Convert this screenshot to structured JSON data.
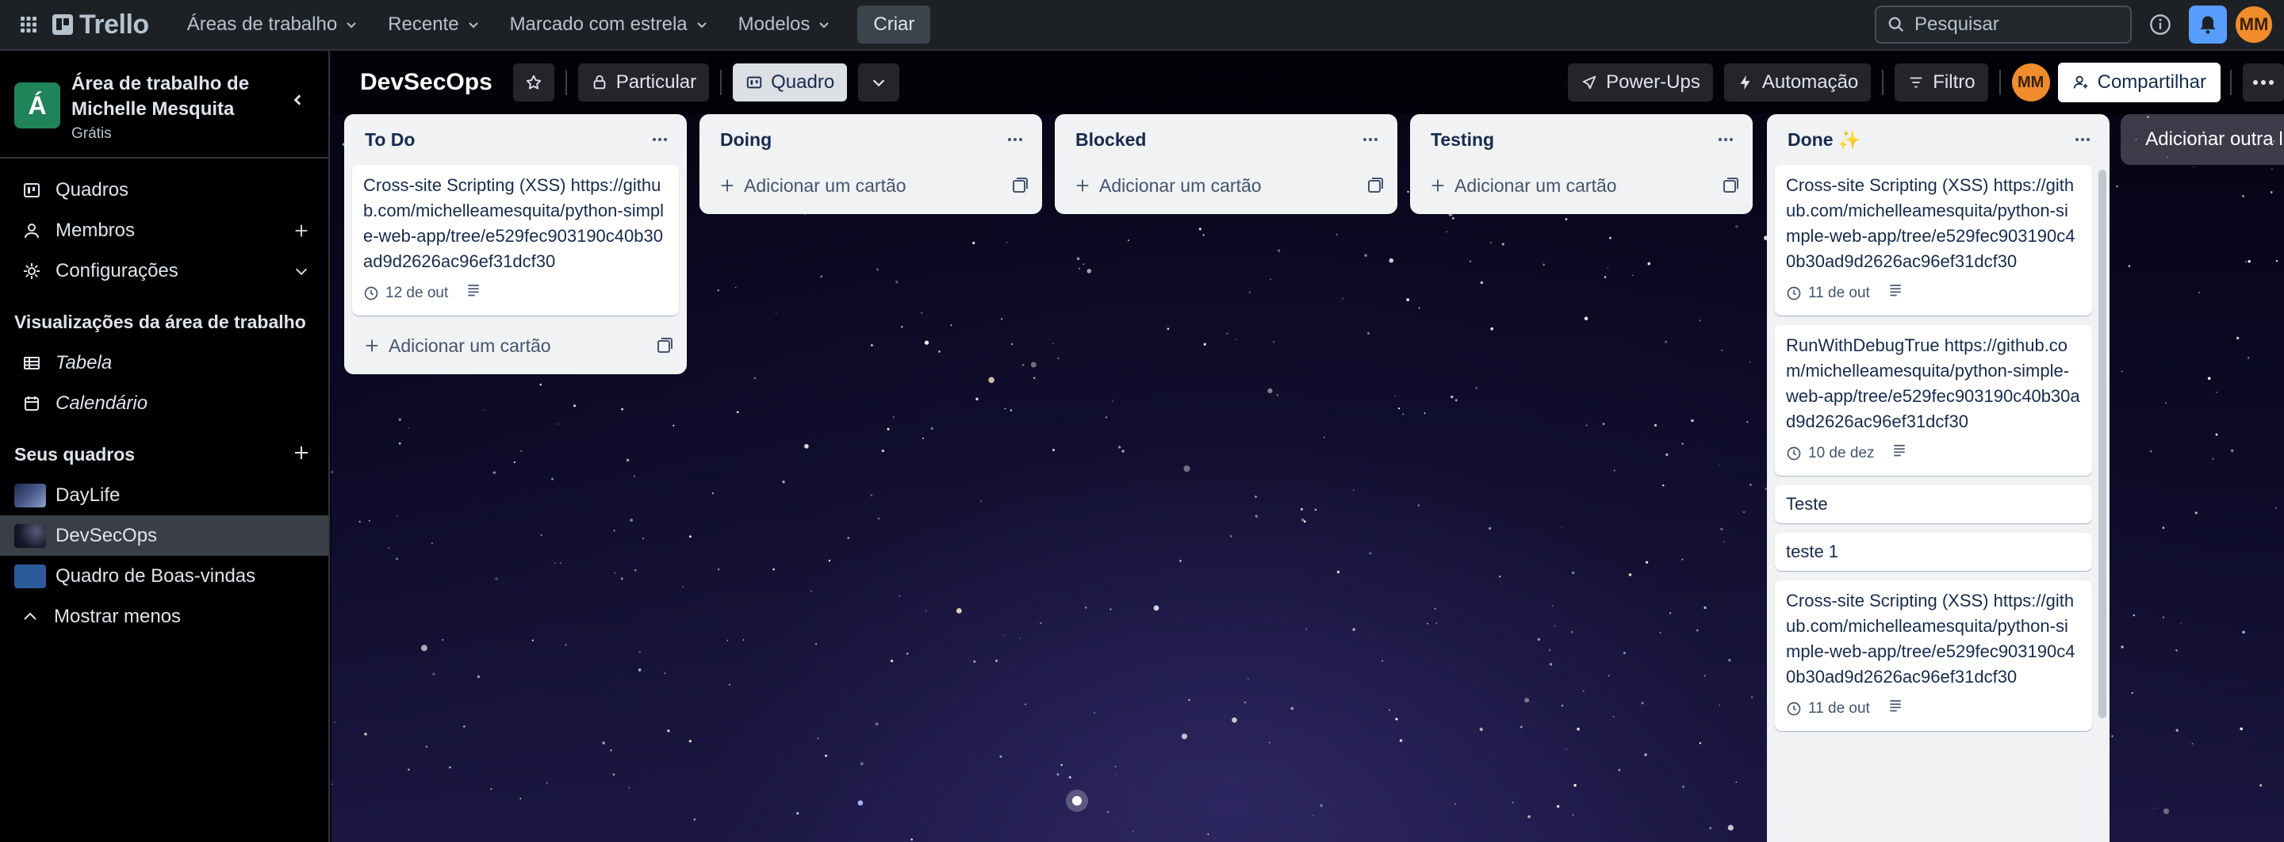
{
  "topbar": {
    "logo": "Trello",
    "menus": [
      "Áreas de trabalho",
      "Recente",
      "Marcado com estrela",
      "Modelos"
    ],
    "create_label": "Criar",
    "search_placeholder": "Pesquisar",
    "avatar_initials": "MM"
  },
  "sidebar": {
    "workspace_initial": "Á",
    "workspace_name": "Área de trabalho de Michelle Mesquita",
    "workspace_plan": "Grátis",
    "nav": [
      {
        "label": "Quadros",
        "icon": "board-icon"
      },
      {
        "label": "Membros",
        "icon": "members-icon"
      },
      {
        "label": "Configurações",
        "icon": "gear-icon"
      }
    ],
    "views_heading": "Visualizações da área de trabalho",
    "views": [
      {
        "label": "Tabela",
        "icon": "table-icon"
      },
      {
        "label": "Calendário",
        "icon": "calendar-icon"
      }
    ],
    "boards_heading": "Seus quadros",
    "boards": [
      {
        "label": "DayLife",
        "active": false
      },
      {
        "label": "DevSecOps",
        "active": true
      },
      {
        "label": "Quadro de Boas-vindas",
        "active": false
      }
    ],
    "show_less": "Mostrar menos"
  },
  "board": {
    "title": "DevSecOps",
    "visibility": "Particular",
    "view": "Quadro",
    "powerups": "Power-Ups",
    "automation": "Automação",
    "filter": "Filtro",
    "member_initials": "MM",
    "share": "Compartilhar",
    "add_card": "Adicionar um cartão",
    "add_list": "Adicionar outra lista",
    "lists": [
      {
        "title": "To Do",
        "cards": [
          {
            "text": "Cross-site Scripting (XSS) https://github.com/michelleamesquita/python-simple-web-app/tree/e529fec903190c40b30ad9d2626ac96ef31dcf30",
            "due": "12 de out",
            "desc": true
          }
        ]
      },
      {
        "title": "Doing",
        "cards": []
      },
      {
        "title": "Blocked",
        "cards": []
      },
      {
        "title": "Testing",
        "cards": []
      },
      {
        "title": "Done ✨",
        "cards": [
          {
            "text": "Cross-site Scripting (XSS) https://github.com/michelleamesquita/python-simple-web-app/tree/e529fec903190c40b30ad9d2626ac96ef31dcf30",
            "due": "11 de out",
            "desc": true
          },
          {
            "text": "RunWithDebugTrue https://github.com/michelleamesquita/python-simple-web-app/tree/e529fec903190c40b30ad9d2626ac96ef31dcf30",
            "due": "10 de dez",
            "desc": true
          },
          {
            "text": "Teste"
          },
          {
            "text": "teste 1"
          },
          {
            "text": "Cross-site Scripting (XSS) https://github.com/michelleamesquita/python-simple-web-app/tree/e529fec903190c40b30ad9d2626ac96ef31dcf30",
            "due": "11 de out",
            "desc": true
          }
        ]
      }
    ]
  },
  "colors": {
    "header_bg": "#1d2125",
    "sidebar_bg": "#000000",
    "list_bg": "#f1f2f4",
    "workspace_avatar": "#1f845a",
    "member_avatar": "#f08c2b",
    "notification_bell": "#579dff"
  }
}
